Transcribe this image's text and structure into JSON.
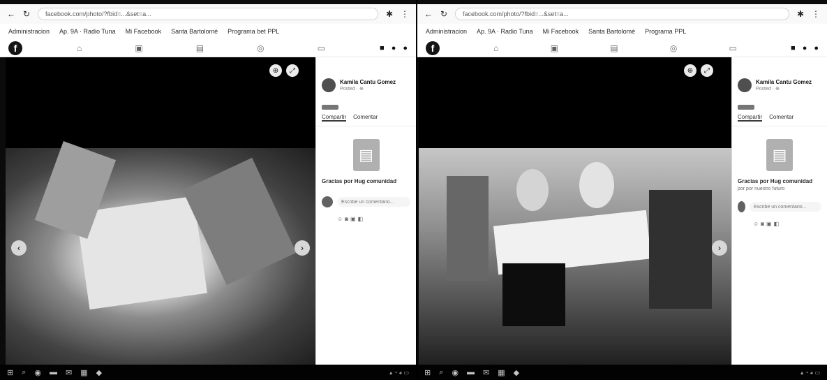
{
  "screens": [
    {
      "id": "left",
      "url": "facebook.com/photo/?fbid=...&set=a...",
      "bookmarks": [
        "Administracion",
        "Ap. 9A · Radio Tuna",
        "Mi Facebook",
        "Santa Bartolomé",
        "Programa bet PPL"
      ],
      "post": {
        "author": "Kamila Cantu Gomez",
        "meta": "Posted · ⊕",
        "tabs": [
          "Compartir",
          "Comentar"
        ],
        "caption": "Gracias por Hug comunidad",
        "sub": "",
        "comment_placeholder": "Escribe un comentario..."
      }
    },
    {
      "id": "right",
      "url": "facebook.com/photo/?fbid=...&set=a...",
      "bookmarks": [
        "Administracion",
        "Ap. 9A · Radio Tuna",
        "Mi Facebook",
        "Santa Bartolomé",
        "Programa PPL"
      ],
      "post": {
        "author": "Kamila Cantu Gomez",
        "meta": "Posted · ⊕",
        "tabs": [
          "Compartir",
          "Comentar"
        ],
        "caption": "Gracias por Hug comunidad",
        "sub": "por por nuestro futuro",
        "comment_placeholder": "Escribe un comentario..."
      }
    }
  ],
  "icons": {
    "back": "arrow-left-icon",
    "forward": "arrow-right-icon",
    "reload": "reload-icon",
    "prev_photo": "chevron-left-icon",
    "next_photo": "chevron-right-icon",
    "zoom": "zoom-icon",
    "fullscreen": "expand-icon"
  }
}
